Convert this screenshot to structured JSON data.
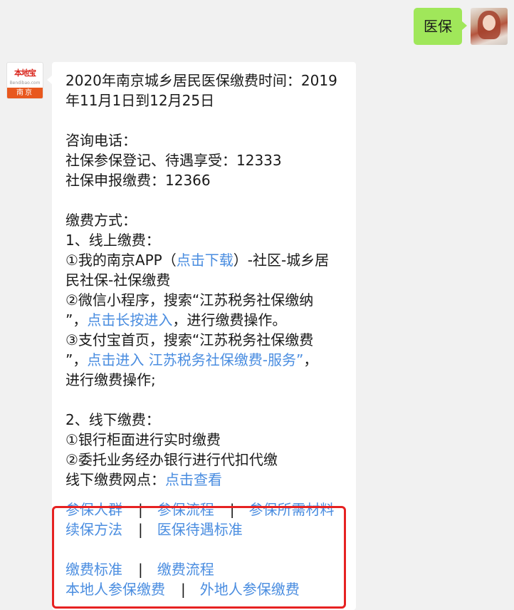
{
  "user_message": {
    "text": "医保"
  },
  "bot": {
    "logo_text": "本地宝",
    "logo_sub": "Bendibao.com",
    "logo_city": "南京",
    "lines": [
      [
        "2020年南京城乡居民医保缴费时间：2019"
      ],
      [
        "年11月1日到12月25日"
      ],
      [],
      [
        "咨询电话："
      ],
      [
        "社保参保登记、待遇享受：12333"
      ],
      [
        "社保申报缴费：12366"
      ],
      [],
      [
        "缴费方式："
      ],
      [
        "1、线上缴费："
      ]
    ],
    "app_line_1": {
      "pre": "①我的南京APP（",
      "link": "点击下载",
      "post": "）-社区-城乡居"
    },
    "app_line_2": "民社保-社保缴费",
    "wechat_line_1": "②微信小程序，搜索“江苏税务社保缴纳",
    "wechat_line_2": {
      "pre": "”，",
      "link": "点击长按进入",
      "post": "，进行缴费操作。"
    },
    "alipay_line_1": "③支付宝首页，搜索“江苏税务社保缴费",
    "alipay_line_2": {
      "pre": "”，",
      "link": "点击进入 江苏税务社保缴费-服务”",
      "post": "，"
    },
    "alipay_line_3": "进行缴费操作;",
    "offline_title": "2、线下缴费：",
    "offline_1": "①银行柜面进行实时缴费",
    "offline_2": "②委托业务经办银行进行代扣代缴",
    "offline_points": {
      "pre": "线下缴费网点：",
      "link": "点击查看"
    },
    "nav": {
      "row1": [
        "参保人群",
        "参保流程",
        "参保所需材料"
      ],
      "row2": [
        "续保方法",
        "医保待遇标准"
      ],
      "row3": [
        "缴费标准",
        "缴费流程"
      ],
      "row4": [
        "本地人参保缴费",
        "外地人参保缴费"
      ],
      "separator": "|"
    }
  },
  "colors": {
    "link": "#4a8de0",
    "user_bubble": "#a0e75a",
    "highlight_box": "#e62222",
    "background": "#f1f1f1"
  }
}
